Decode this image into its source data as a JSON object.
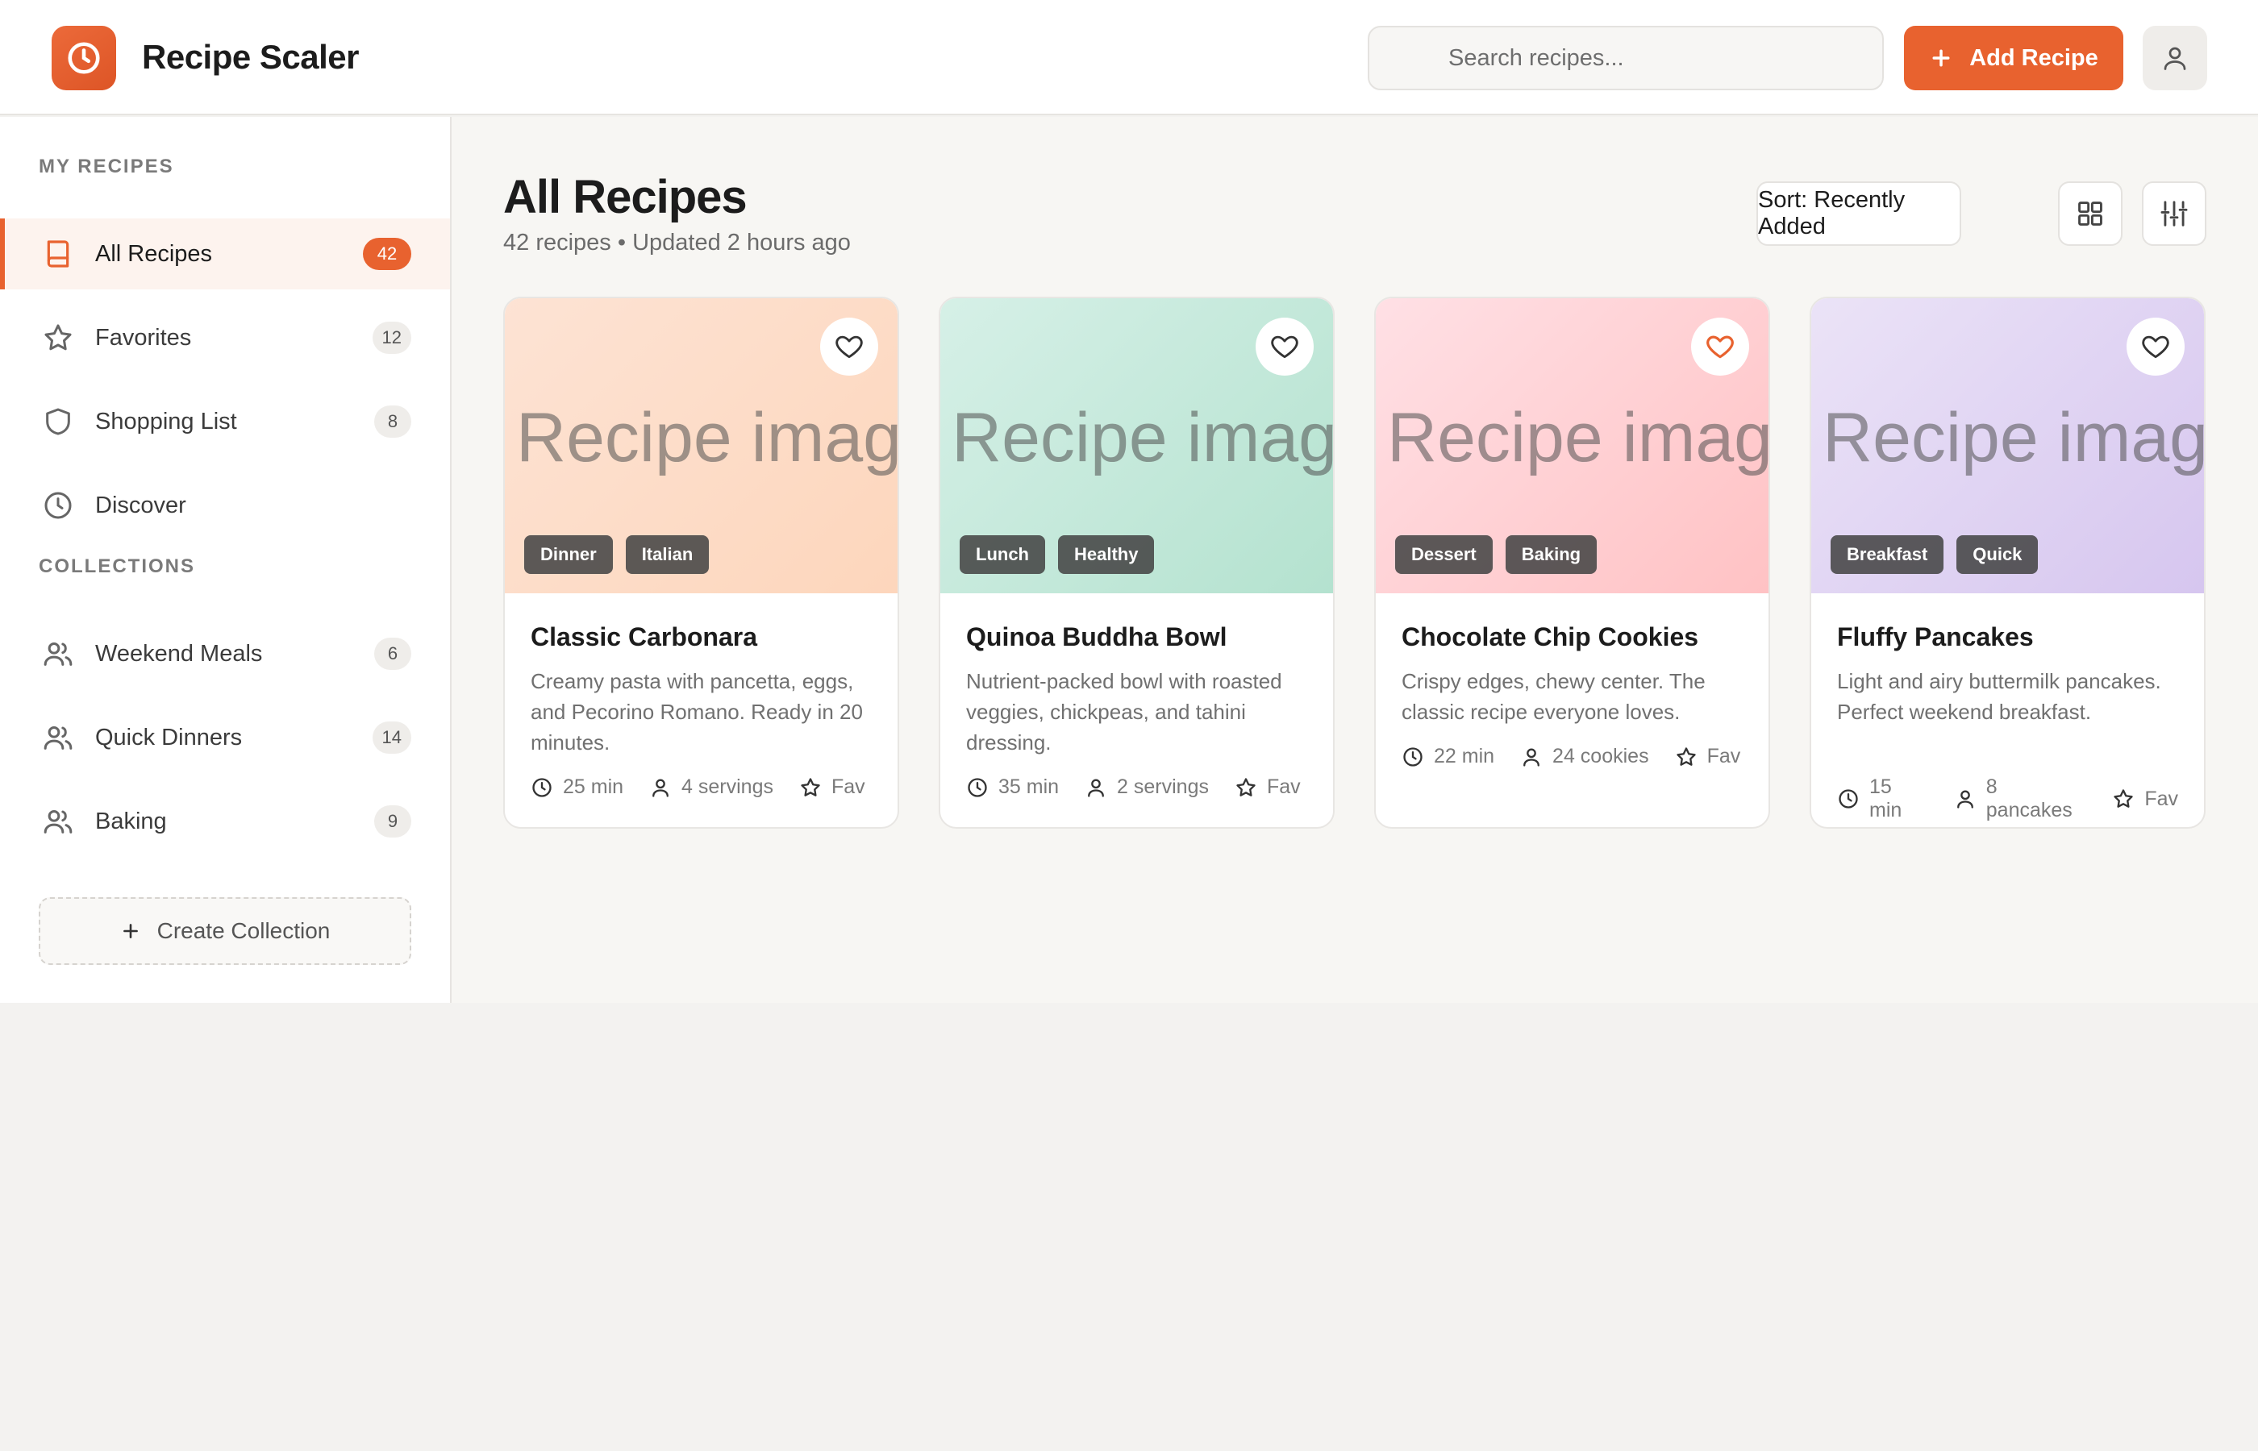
{
  "app": {
    "title": "Recipe Scaler",
    "accent_color": "#e8622f",
    "logo_icon": "clock-icon"
  },
  "header": {
    "search_placeholder": "Search recipes...",
    "add_label": "Add Recipe",
    "add_icon": "plus-icon",
    "profile_icon": "user-icon"
  },
  "sidebar": {
    "my_recipes_title": "MY RECIPES",
    "items": [
      {
        "label": "All Recipes",
        "count": "42",
        "icon": "book-icon",
        "active": true
      },
      {
        "label": "Favorites",
        "count": "12",
        "icon": "star-icon"
      },
      {
        "label": "Shopping List",
        "count": "8",
        "icon": "shield-icon"
      },
      {
        "label": "Discover",
        "count": "",
        "icon": "clock-icon"
      }
    ],
    "collections_title": "COLLECTIONS",
    "collections": [
      {
        "label": "Weekend Meals",
        "count": "6",
        "icon": "users-icon"
      },
      {
        "label": "Quick Dinners",
        "count": "14",
        "icon": "users-icon"
      },
      {
        "label": "Baking",
        "count": "9",
        "icon": "users-icon"
      }
    ],
    "create_label": "Create Collection"
  },
  "main": {
    "title": "All Recipes",
    "subtitle": "42 recipes • Updated 2 hours ago",
    "sort_label": "Sort: Recently Added",
    "grid_icon": "grid-icon",
    "filter_icon": "sliders-icon"
  },
  "recipes": [
    {
      "image_text": "Recipe image",
      "tags": [
        "Dinner",
        "Italian"
      ],
      "title": "Classic Carbonara",
      "description": "Creamy pasta with pancetta, eggs, and Pecorino Romano. Ready in 20 minutes.",
      "time": "25 min",
      "yield": "4 servings",
      "fav_label": "Fav",
      "favorited": false,
      "gradient": [
        "#fde1d0",
        "#fdd8bf"
      ]
    },
    {
      "image_text": "Recipe image",
      "tags": [
        "Lunch",
        "Healthy"
      ],
      "title": "Quinoa Buddha Bowl",
      "description": "Nutrient-packed bowl with roasted veggies, chickpeas, and tahini dressing.",
      "time": "35 min",
      "yield": "2 servings",
      "fav_label": "Fav",
      "favorited": false,
      "gradient": [
        "#d3efe6",
        "#b5e3d1"
      ]
    },
    {
      "image_text": "Recipe image",
      "tags": [
        "Dessert",
        "Baking"
      ],
      "title": "Chocolate Chip Cookies",
      "description": "Crispy edges, chewy center. The classic recipe everyone loves.",
      "time": "22 min",
      "yield": "24 cookies",
      "fav_label": "Fav",
      "favorited": true,
      "gradient": [
        "#ffdde2",
        "#ffc3c5"
      ]
    },
    {
      "image_text": "Recipe image",
      "tags": [
        "Breakfast",
        "Quick"
      ],
      "title": "Fluffy Pancakes",
      "description": "Light and airy buttermilk pancakes. Perfect weekend breakfast.",
      "time": "15 min",
      "yield": "8 pancakes",
      "fav_label": "Fav",
      "favorited": false,
      "gradient": [
        "#e8e0f6",
        "#d7c8f0"
      ]
    }
  ]
}
